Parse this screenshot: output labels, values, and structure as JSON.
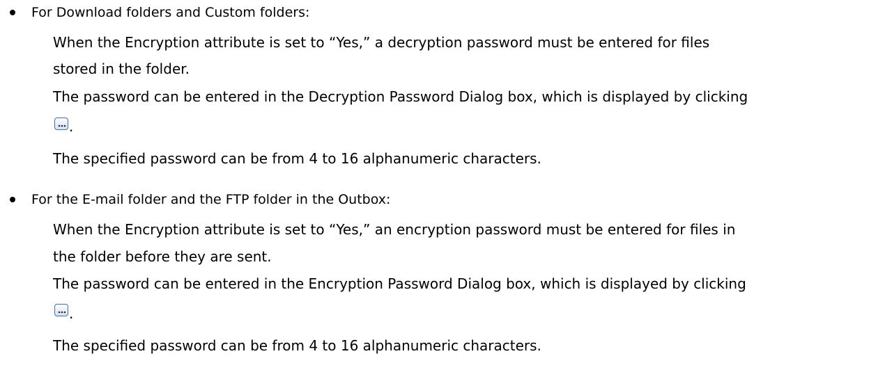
{
  "sections": [
    {
      "heading": "For Download folders and Custom folders:",
      "line1": "When the Encryption attribute is set to “Yes,” a decryption password must be entered for files",
      "line2": "stored in the folder.",
      "line3": "The password can be entered in the Decryption Password Dialog box, which is displayed by clicking",
      "button_icon": "ellipsis-button-icon",
      "punctuation": ".",
      "line4": "The specified password can be from 4 to 16 alphanumeric characters."
    },
    {
      "heading": "For the E-mail folder and the FTP folder in the Outbox:",
      "line1": "When the Encryption attribute is set to “Yes,” an encryption password must be entered for files in",
      "line2": "the folder before they are sent.",
      "line3": "The password can be entered in the Encryption Password Dialog box, which is displayed by clicking",
      "button_icon": "ellipsis-button-icon",
      "punctuation": ".",
      "line4": "The specified password can be from 4 to 16 alphanumeric characters."
    }
  ]
}
